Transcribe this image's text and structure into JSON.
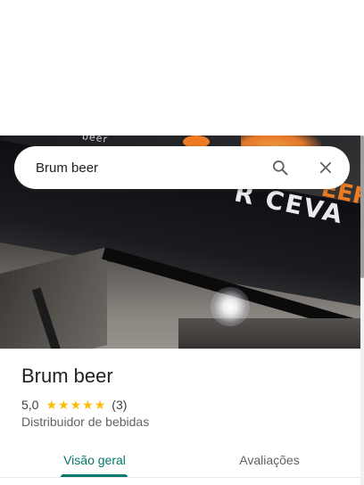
{
  "search": {
    "value": "Brum beer",
    "search_icon": "search-icon",
    "close_icon": "close-icon"
  },
  "hero": {
    "sign_text": "R CEVA",
    "sign_orange": "EER",
    "top_text": "beer"
  },
  "place": {
    "name": "Brum beer",
    "rating": "5,0",
    "stars": 5,
    "review_count": "(3)",
    "category": "Distribuidor de bebidas"
  },
  "tabs": [
    {
      "label": "Visão geral",
      "active": true
    },
    {
      "label": "Avaliações",
      "active": false
    }
  ],
  "colors": {
    "accent": "#00796b",
    "star": "#fbbc04",
    "text": "#202124",
    "secondary_text": "#5f6368"
  }
}
